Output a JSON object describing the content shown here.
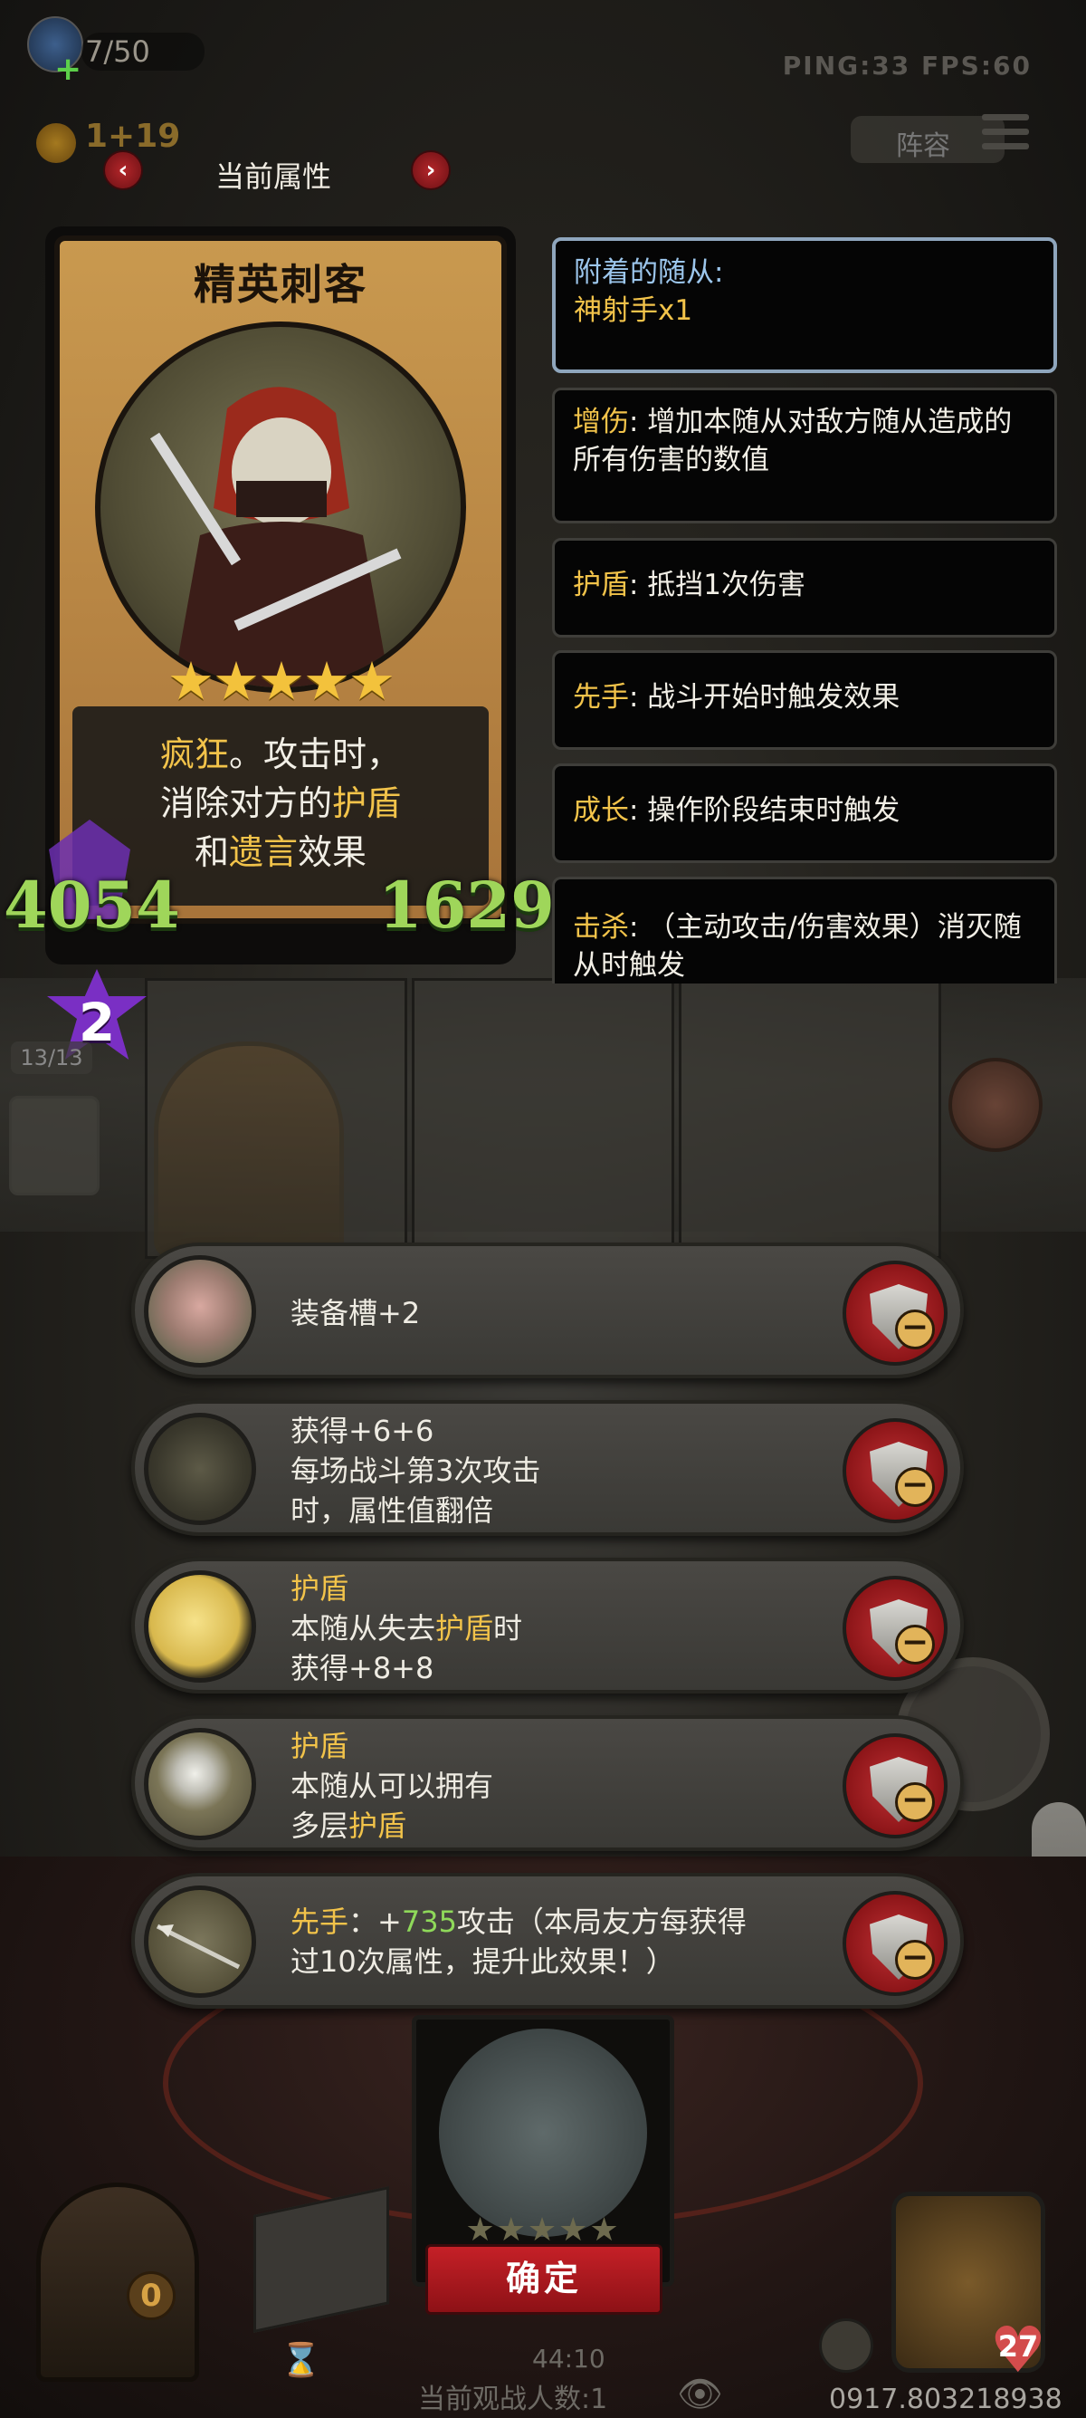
{
  "hud": {
    "player_count": "7/50",
    "ping_fps": "PING:33  FPS:60",
    "gold": "1+19",
    "lineup_label": "阵容"
  },
  "attributes": {
    "title": "当前属性",
    "prev_label": "‹",
    "next_label": "›"
  },
  "card": {
    "name": "精英刺客",
    "stars": "★★★★★",
    "desc_line1_a": "疯狂",
    "desc_line1_b": "。攻击时，",
    "desc_line2_a": "消除对方的",
    "desc_line2_b": "护盾",
    "desc_line3_a": "和",
    "desc_line3_b": "遗言",
    "desc_line3_c": "效果",
    "attack": "4054",
    "health": "1629",
    "tier": "2",
    "slot_counter": "13/13"
  },
  "tooltips": [
    {
      "label": "附着的随从:",
      "value": "神射手x1"
    },
    {
      "keyword": "增伤",
      "text": ": 增加本随从对敌方随从造成的所有伤害的数值"
    },
    {
      "keyword": "护盾",
      "text": ": 抵挡1次伤害"
    },
    {
      "keyword": "先手",
      "text": ": 战斗开始时触发效果"
    },
    {
      "keyword": "成长",
      "text": ": 操作阶段结束时触发"
    },
    {
      "keyword": "击杀",
      "text": ": （主动攻击/伤害效果）消灭随从时触发"
    }
  ],
  "bonuses": [
    {
      "icon": "pig-icon",
      "line1": "装备槽+2"
    },
    {
      "icon": "cloak-icon",
      "line1": "获得+6+6",
      "line2": "每场战斗第3次攻击",
      "line3": "时，属性值翻倍"
    },
    {
      "icon": "moon-icon",
      "title": "护盾",
      "line2a": "本随从失去",
      "line2b": "护盾",
      "line2c": "时",
      "line3": "获得+8+8"
    },
    {
      "icon": "mirror-icon",
      "title": "护盾",
      "line2": "本随从可以拥有",
      "line3a": "多层",
      "line3b": "护盾"
    },
    {
      "icon": "spear-icon",
      "kw": "先手",
      "line1b": "：+",
      "line1c": "735",
      "line1d": "攻击（本局友方每获得",
      "line2": "过10次属性，提升此效果！）"
    }
  ],
  "minus_label": "−",
  "bottom": {
    "stars": "★★★★★",
    "confirm_label": "确定",
    "chest_count": "0",
    "timer": "44:10",
    "spectators": "当前观战人数:1",
    "phone": "0917.803218938",
    "hp": "27"
  },
  "colors": {
    "keyword_gold": "#f2c34a",
    "stat_green": "#9fd65a",
    "confirm_red": "#c52027",
    "panel_border_active": "#8fa6bd"
  }
}
